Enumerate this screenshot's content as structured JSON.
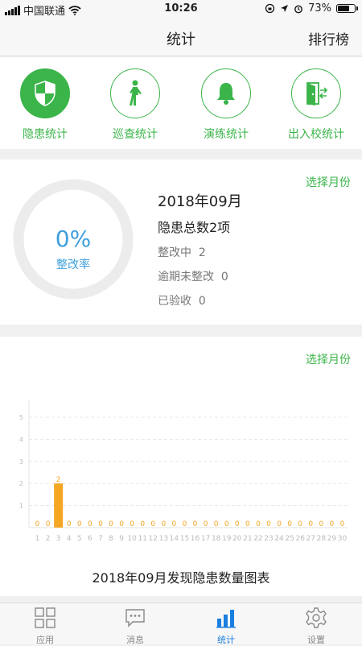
{
  "status_bar": {
    "carrier": "中国联通",
    "time": "10:26",
    "battery": "73%",
    "battery_level": 0.73
  },
  "header": {
    "title": "统计",
    "right_action": "排行榜"
  },
  "categories": [
    {
      "label": "隐患统计",
      "icon": "shield-icon",
      "active": true
    },
    {
      "label": "巡查统计",
      "icon": "walking-person-icon",
      "active": false
    },
    {
      "label": "演练统计",
      "icon": "bell-icon",
      "active": false
    },
    {
      "label": "出入校统计",
      "icon": "door-exit-icon",
      "active": false
    }
  ],
  "summary": {
    "select_month": "选择月份",
    "month": "2018年09月",
    "total": "隐患总数2项",
    "rate_value": "0%",
    "rate_label": "整改率",
    "rate_fraction": 0,
    "rows": [
      {
        "label": "整改中",
        "value": "2"
      },
      {
        "label": "逾期未整改",
        "value": "0"
      },
      {
        "label": "已验收",
        "value": "0"
      }
    ]
  },
  "chart_section": {
    "select_month": "选择月份",
    "title": "2018年09月发现隐患数量图表"
  },
  "chart_data": {
    "type": "bar",
    "title": "2018年09月发现隐患数量图表",
    "categories": [
      "1",
      "2",
      "3",
      "4",
      "5",
      "6",
      "7",
      "8",
      "9",
      "10",
      "11",
      "12",
      "13",
      "14",
      "15",
      "16",
      "17",
      "18",
      "19",
      "20",
      "21",
      "22",
      "23",
      "24",
      "25",
      "26",
      "27",
      "28",
      "29",
      "30"
    ],
    "values": [
      0,
      0,
      2,
      0,
      0,
      0,
      0,
      0,
      0,
      0,
      0,
      0,
      0,
      0,
      0,
      0,
      0,
      0,
      0,
      0,
      0,
      0,
      0,
      0,
      0,
      0,
      0,
      0,
      0,
      0
    ],
    "y_ticks": [
      "0",
      "1",
      "2",
      "3",
      "4",
      "5"
    ],
    "ylim": [
      0,
      5
    ],
    "grid": true,
    "bar_color": "#f5a623"
  },
  "tabbar": {
    "items": [
      {
        "label": "应用",
        "icon": "apps-grid-icon",
        "active": false
      },
      {
        "label": "消息",
        "icon": "message-icon",
        "active": false
      },
      {
        "label": "统计",
        "icon": "bar-chart-icon",
        "active": true
      },
      {
        "label": "设置",
        "icon": "settings-gear-icon",
        "active": false
      }
    ]
  }
}
